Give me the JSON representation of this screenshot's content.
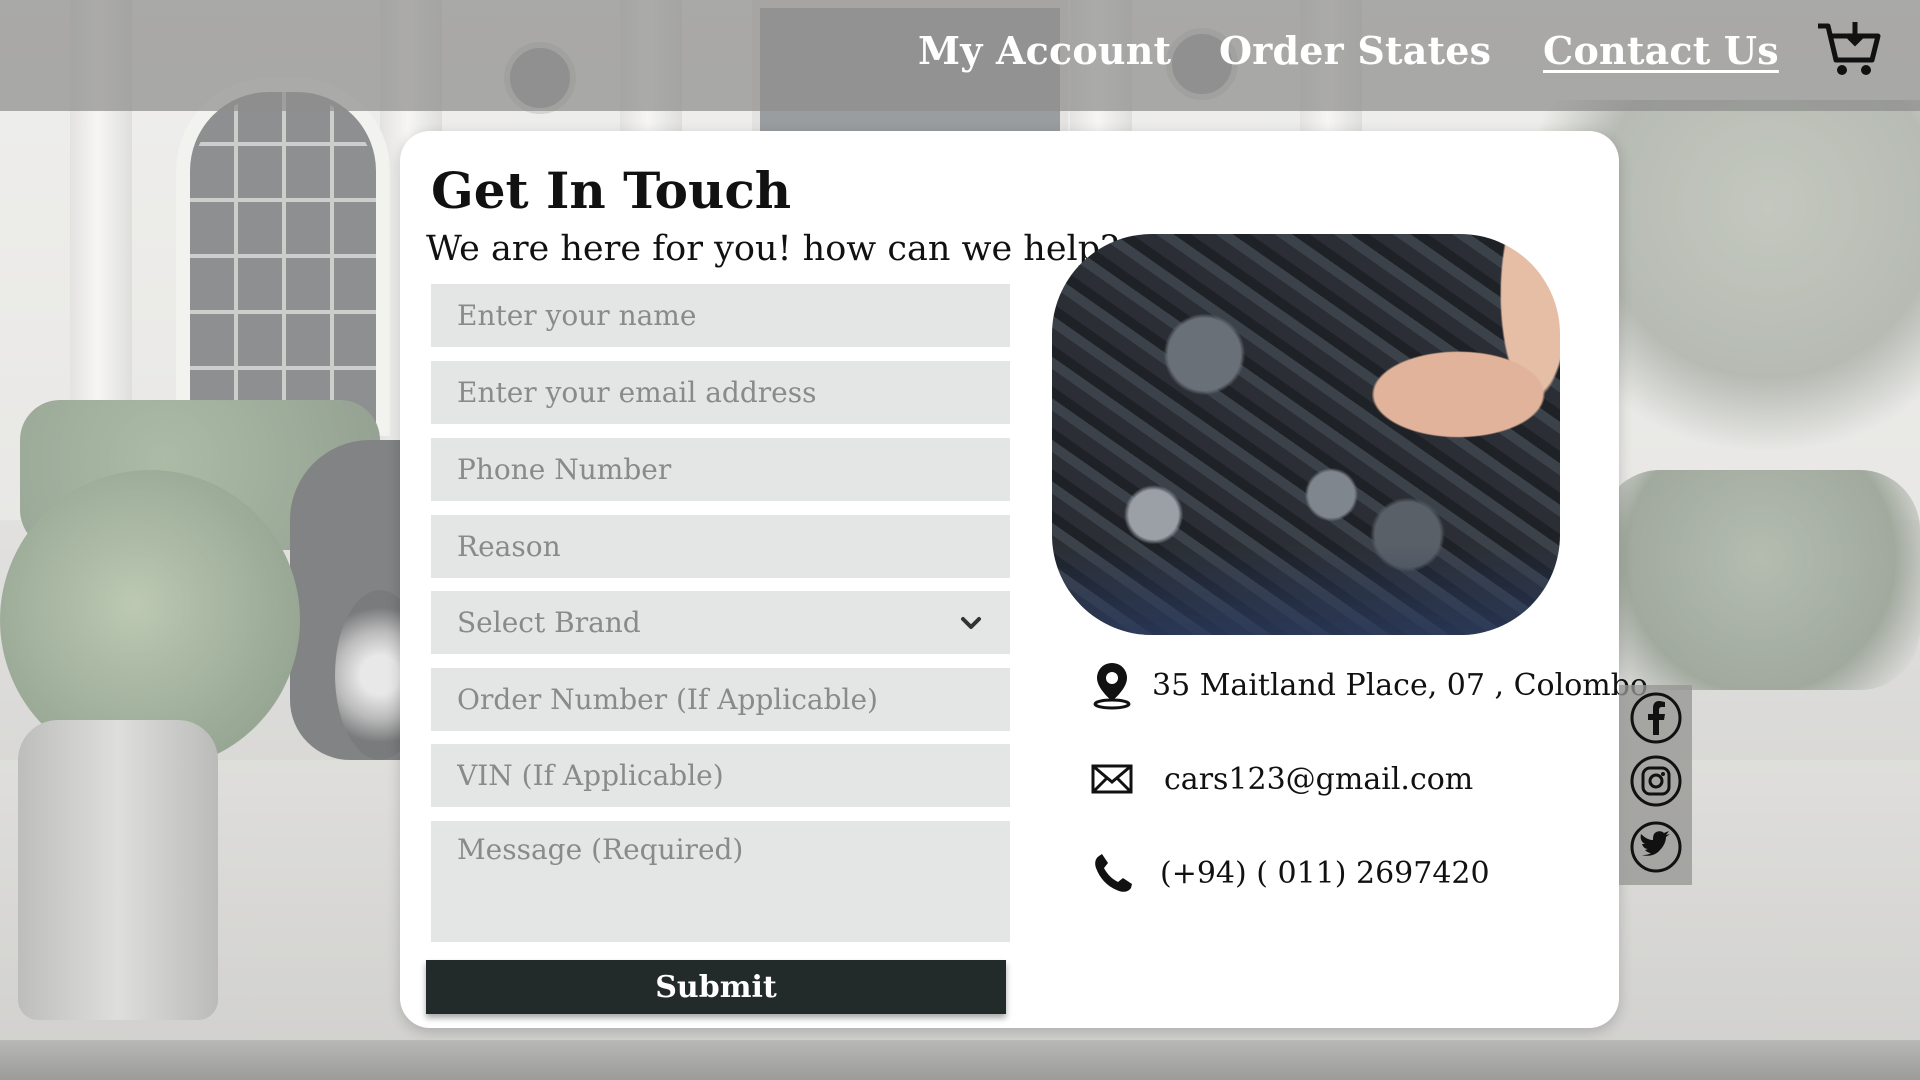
{
  "nav": {
    "items": [
      {
        "label": "My Account"
      },
      {
        "label": "Order States"
      },
      {
        "label": "Contact Us",
        "active": true
      }
    ],
    "cart_icon": "cart-icon"
  },
  "contact": {
    "title": "Get In Touch",
    "subtitle": "We are here for you! how can we help?"
  },
  "form": {
    "name_placeholder": "Enter your name",
    "email_placeholder": "Enter your email address",
    "phone_placeholder": "Phone Number",
    "reason_placeholder": "Reason",
    "brand_select": "Select Brand",
    "order_placeholder": "Order Number (If Applicable)",
    "vin_placeholder": "VIN (If Applicable)",
    "message_placeholder": "Message (Required)",
    "submit_label": "Submit"
  },
  "info": {
    "address": "35 Maitland Place, 07 , Colombo",
    "email": "cars123@gmail.com",
    "phone": "(+94) ( 011) 2697420"
  },
  "social": {
    "icons": [
      "facebook-icon",
      "instagram-icon",
      "twitter-icon"
    ]
  },
  "colors": {
    "field_bg": "#e4e5e5",
    "submit_bg": "#232a2a",
    "header_overlay": "#8e8e8c"
  }
}
